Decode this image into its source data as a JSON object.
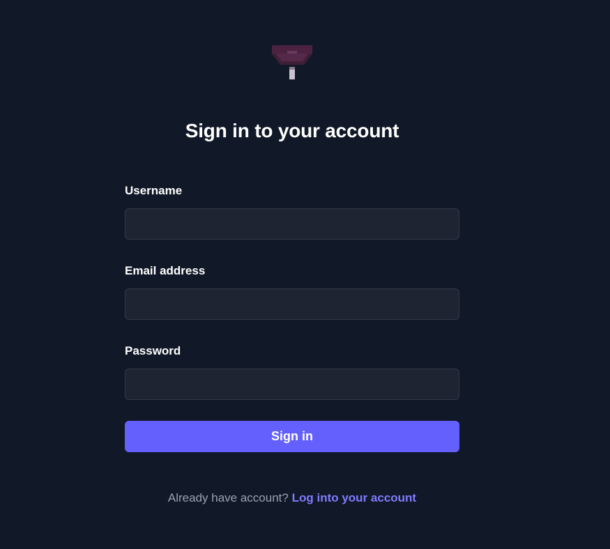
{
  "logo": {
    "icon": "brand-logo-icon"
  },
  "heading": "Sign in to your account",
  "form": {
    "username_label": "Username",
    "username_value": "",
    "email_label": "Email address",
    "email_value": "",
    "password_label": "Password",
    "password_value": "",
    "submit_label": "Sign in"
  },
  "footer": {
    "prompt": "Already have account?",
    "link_label": "Log into your account"
  },
  "colors": {
    "background": "#111827",
    "input_bg": "#1f2433",
    "accent": "#6360fd",
    "link": "#7f7cff",
    "muted_text": "#9ca3af"
  }
}
